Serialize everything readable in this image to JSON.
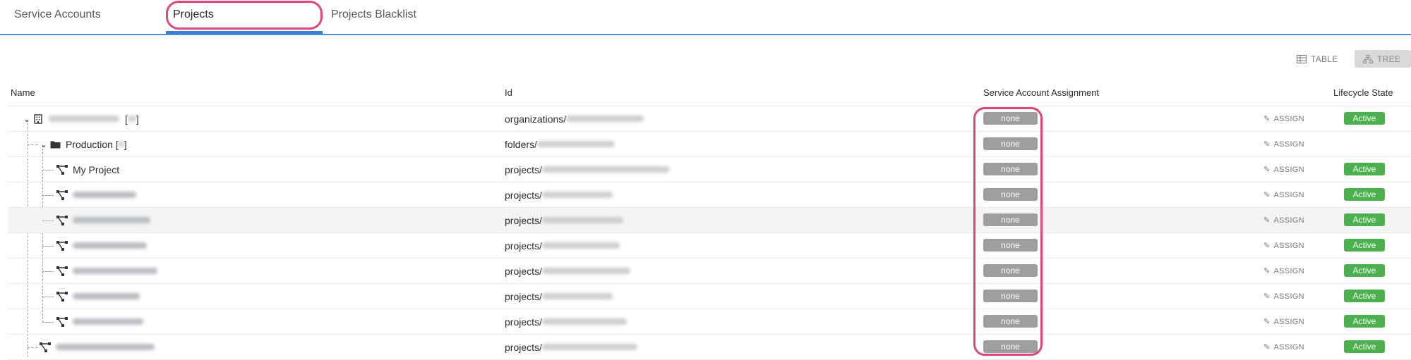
{
  "tabs": [
    {
      "label": "Service Accounts",
      "active": false
    },
    {
      "label": "Projects",
      "active": true
    },
    {
      "label": "Projects Blacklist",
      "active": false
    }
  ],
  "view_toggle": {
    "table": "TABLE",
    "tree": "TREE",
    "selected": "TREE"
  },
  "columns": {
    "name": "Name",
    "id": "Id",
    "assignment": "Service Account Assignment",
    "lifecycle": "Lifecycle State"
  },
  "rows": [
    {
      "type": "organization",
      "icon": "building-icon",
      "name_suffix": "[",
      "name_suffix_end": "]",
      "id_prefix": "organizations/",
      "assignment": "none",
      "assign_label": "ASSIGN",
      "state": "Active"
    },
    {
      "type": "folder",
      "icon": "folder-icon",
      "name": "Production [",
      "name_end": "]",
      "id_prefix": "folders/",
      "assignment": "none",
      "assign_label": "ASSIGN",
      "state": ""
    },
    {
      "type": "project",
      "icon": "project-icon",
      "name": "My Project",
      "id_prefix": "projects/",
      "assignment": "none",
      "assign_label": "ASSIGN",
      "state": "Active"
    },
    {
      "type": "project",
      "icon": "project-icon",
      "id_prefix": "projects/",
      "assignment": "none",
      "assign_label": "ASSIGN",
      "state": "Active"
    },
    {
      "type": "project",
      "icon": "project-icon",
      "id_prefix": "projects/",
      "assignment": "none",
      "assign_label": "ASSIGN",
      "state": "Active"
    },
    {
      "type": "project",
      "icon": "project-icon",
      "id_prefix": "projects/",
      "assignment": "none",
      "assign_label": "ASSIGN",
      "state": "Active"
    },
    {
      "type": "project",
      "icon": "project-icon",
      "id_prefix": "projects/",
      "assignment": "none",
      "assign_label": "ASSIGN",
      "state": "Active"
    },
    {
      "type": "project",
      "icon": "project-icon",
      "id_prefix": "projects/",
      "assignment": "none",
      "assign_label": "ASSIGN",
      "state": "Active"
    },
    {
      "type": "project",
      "icon": "project-icon",
      "id_prefix": "projects/",
      "assignment": "none",
      "assign_label": "ASSIGN",
      "state": "Active"
    },
    {
      "type": "project",
      "icon": "project-icon",
      "id_prefix": "projects/",
      "assignment": "none",
      "assign_label": "ASSIGN",
      "state": "Active"
    }
  ],
  "colors": {
    "accent": "#3a7bd5",
    "highlight": "#e0457b",
    "active": "#4caf50",
    "none_badge": "#9e9e9e"
  }
}
